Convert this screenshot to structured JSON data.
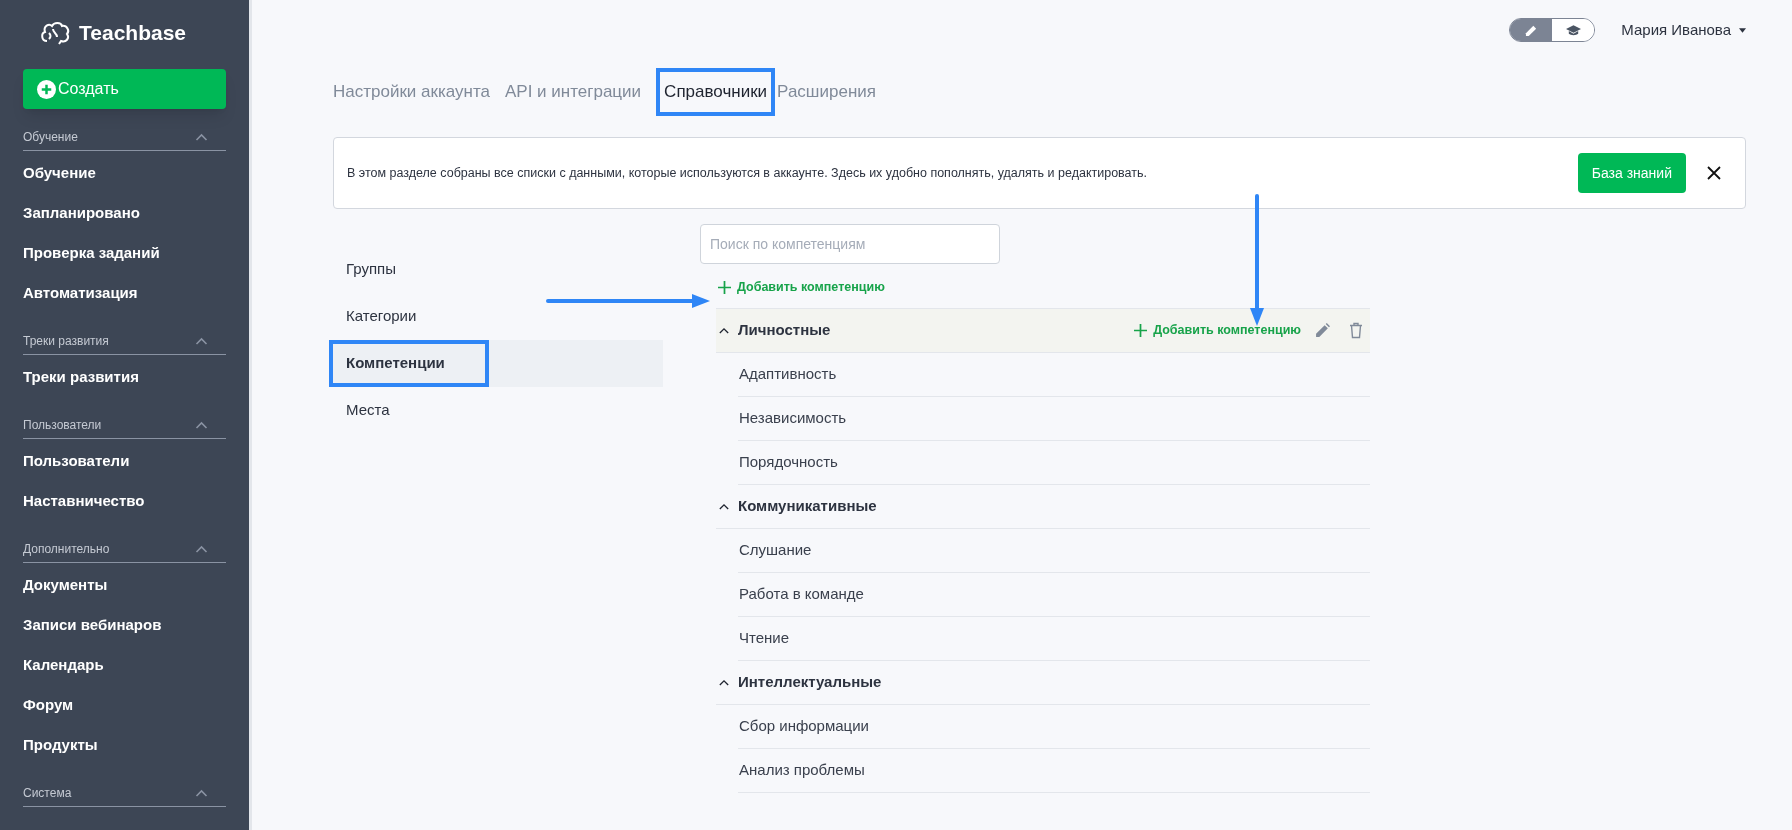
{
  "sidebar": {
    "logo": "Teachbase",
    "create_button": "Создать",
    "sections": [
      {
        "title": "Обучение",
        "expanded": true,
        "items": [
          "Обучение",
          "Запланировано",
          "Проверка заданий",
          "Автоматизация"
        ]
      },
      {
        "title": "Треки развития",
        "expanded": true,
        "items": [
          "Треки развития"
        ]
      },
      {
        "title": "Пользователи",
        "expanded": true,
        "items": [
          "Пользователи",
          "Наставничество"
        ]
      },
      {
        "title": "Дополнительно",
        "expanded": true,
        "items": [
          "Документы",
          "Записи вебинаров",
          "Календарь",
          "Форум",
          "Продукты"
        ]
      },
      {
        "title": "Система",
        "expanded": true
      }
    ]
  },
  "header": {
    "mode_toggle": [
      {
        "kind": "edit",
        "selected": true
      },
      {
        "kind": "learn",
        "selected": false
      }
    ],
    "user_name": "Мария Иванова"
  },
  "tabs": [
    {
      "label": "Настройки аккаунта",
      "selected": false
    },
    {
      "label": "API и интеграции",
      "selected": false
    },
    {
      "label": "Справочники",
      "selected": true
    },
    {
      "label": "Расширения",
      "selected": false
    }
  ],
  "banner": {
    "text": "В этом разделе собраны все списки с данными, которые используются в аккаунте. Здесь их удобно пополнять, удалять и редактировать.",
    "button": "База знаний"
  },
  "categories": [
    {
      "label": "Группы",
      "selected": false
    },
    {
      "label": "Категории",
      "selected": false
    },
    {
      "label": "Компетенции",
      "selected": true
    },
    {
      "label": "Места",
      "selected": false
    }
  ],
  "search": {
    "placeholder": "Поиск по компетенциям"
  },
  "add_link": "Добавить компетенцию",
  "groups": [
    {
      "name": "Личностные",
      "expanded": true,
      "hovered": true,
      "add_link": "Добавить компетенцию",
      "items": [
        "Адаптивность",
        "Независимость",
        "Порядочность"
      ]
    },
    {
      "name": "Коммуникативные",
      "expanded": true,
      "hovered": false,
      "items": [
        "Слушание",
        "Работа в команде",
        "Чтение"
      ]
    },
    {
      "name": "Интеллектуальные",
      "expanded": true,
      "hovered": false,
      "items": [
        "Сбор информации",
        "Анализ проблемы"
      ]
    }
  ]
}
